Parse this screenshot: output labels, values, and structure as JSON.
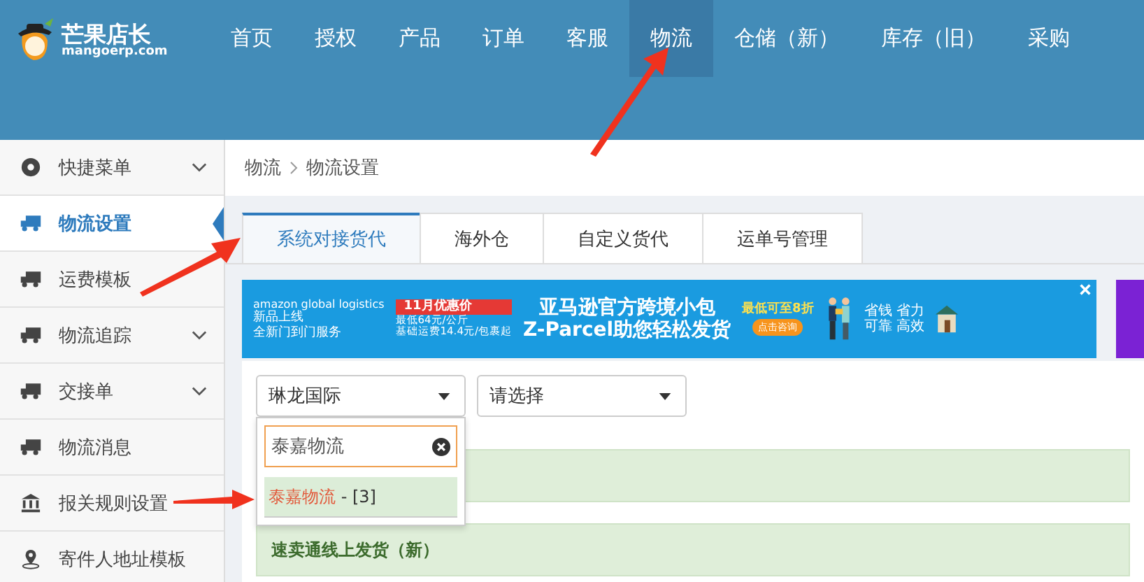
{
  "logo": {
    "name": "芒果店长",
    "domain": "mangoerp.com"
  },
  "nav": [
    {
      "label": "首页",
      "selected": false
    },
    {
      "label": "授权",
      "selected": false
    },
    {
      "label": "产品",
      "selected": false
    },
    {
      "label": "订单",
      "selected": false
    },
    {
      "label": "客服",
      "selected": false
    },
    {
      "label": "物流",
      "selected": true
    },
    {
      "label": "仓储（新）",
      "selected": false
    },
    {
      "label": "库存（旧）",
      "selected": false
    },
    {
      "label": "采购",
      "selected": false
    }
  ],
  "sidebar": {
    "items": [
      {
        "label": "快捷菜单",
        "kind": "gear",
        "expandable": true,
        "selected": false
      },
      {
        "label": "物流设置",
        "kind": "truck",
        "expandable": false,
        "selected": true
      },
      {
        "label": "运费模板",
        "kind": "truck",
        "expandable": false,
        "selected": false
      },
      {
        "label": "物流追踪",
        "kind": "truck",
        "expandable": true,
        "selected": false
      },
      {
        "label": "交接单",
        "kind": "truck",
        "expandable": true,
        "selected": false
      },
      {
        "label": "物流消息",
        "kind": "truck",
        "expandable": false,
        "selected": false
      },
      {
        "label": "报关规则设置",
        "kind": "bank",
        "expandable": false,
        "selected": false
      },
      {
        "label": "寄件人地址模板",
        "kind": "pin",
        "expandable": false,
        "selected": false
      }
    ]
  },
  "breadcrumb": [
    "物流",
    "物流设置"
  ],
  "tabs": [
    {
      "label": "系统对接货代",
      "selected": true
    },
    {
      "label": "海外仓",
      "selected": false
    },
    {
      "label": "自定义货代",
      "selected": false
    },
    {
      "label": "运单号管理",
      "selected": false
    }
  ],
  "banner": {
    "brand": "amazon global logistics",
    "new_line1": "新品上线",
    "new_line2": "全新门到门服务",
    "promo_tag": "11月优惠价",
    "price1": "最低64元/公斤",
    "price2": "基础运费14.4元/包裹起",
    "headline1": "亚马逊官方跨境小包",
    "headline2": "Z-Parcel助您轻松发货",
    "discount": "最低可至8折",
    "cta": "点击咨询",
    "benefit1": "省钱 省力",
    "benefit2": "可靠 高效"
  },
  "filters": {
    "carrier_select": "琳龙国际",
    "second_select": "请选择",
    "search_value": "泰嘉物流",
    "results": [
      {
        "match": "泰嘉物流",
        "rest": " - [3]",
        "selected": true
      }
    ]
  },
  "rows": [
    {},
    {
      "label": "速卖通线上发货（新）"
    }
  ]
}
